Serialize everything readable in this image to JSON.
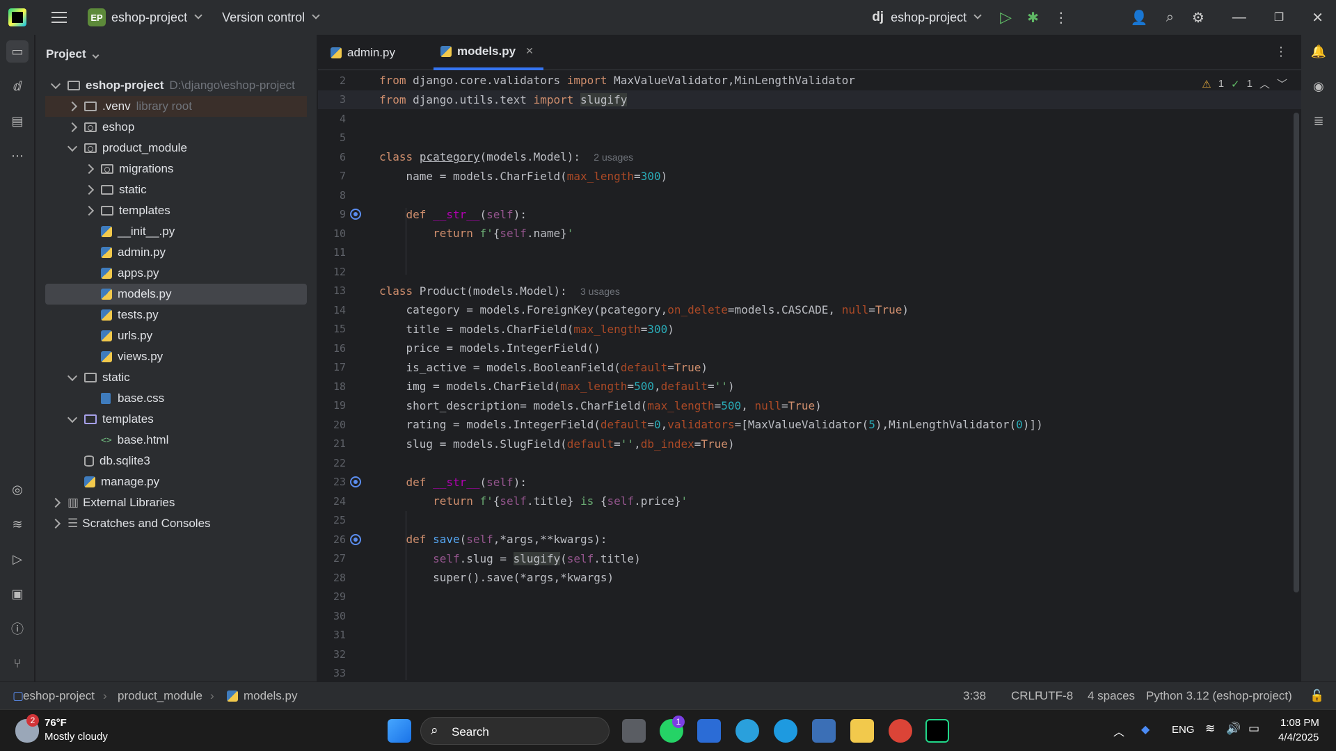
{
  "titlebar": {
    "project_badge": "EP",
    "project_name": "eshop-project",
    "vcs": "Version control",
    "run_config_prefix": "dj",
    "run_config": "eshop-project"
  },
  "panel": {
    "title": "Project"
  },
  "tree": [
    {
      "label": "eshop-project",
      "note": "D:\\django\\eshop-project",
      "bold": true
    },
    {
      "label": ".venv",
      "note": "library root"
    },
    {
      "label": "eshop"
    },
    {
      "label": "product_module"
    },
    {
      "label": "migrations"
    },
    {
      "label": "static"
    },
    {
      "label": "templates"
    },
    {
      "label": "__init__.py"
    },
    {
      "label": "admin.py"
    },
    {
      "label": "apps.py"
    },
    {
      "label": "models.py"
    },
    {
      "label": "tests.py"
    },
    {
      "label": "urls.py"
    },
    {
      "label": "views.py"
    },
    {
      "label": "static"
    },
    {
      "label": "base.css"
    },
    {
      "label": "templates"
    },
    {
      "label": "base.html"
    },
    {
      "label": "db.sqlite3"
    },
    {
      "label": "manage.py"
    },
    {
      "label": "External Libraries"
    },
    {
      "label": "Scratches and Consoles"
    }
  ],
  "tabs": [
    {
      "label": "admin.py"
    },
    {
      "label": "models.py"
    }
  ],
  "editor": {
    "line_numbers": [
      "2",
      "3",
      "4",
      "5",
      "6",
      "7",
      "8",
      "9",
      "10",
      "11",
      "12",
      "13",
      "14",
      "15",
      "16",
      "17",
      "18",
      "19",
      "20",
      "21",
      "22",
      "23",
      "24",
      "25",
      "26",
      "27",
      "28",
      "29",
      "30",
      "31",
      "32",
      "33"
    ],
    "usages_6": "2 usages",
    "usages_13": "3 usages",
    "warn_count": "1",
    "ok_count": "1"
  },
  "statusbar": {
    "crumb1": "eshop-project",
    "crumb2": "product_module",
    "crumb3": "models.py",
    "position": "3:38",
    "line_sep": "CRLF",
    "encoding": "UTF-8",
    "indent": "4 spaces",
    "interpreter": "Python 3.12 (eshop-project)"
  },
  "taskbar": {
    "temp": "76°F",
    "weather": "Mostly cloudy",
    "weather_badge": "2",
    "search": "Search",
    "whatsapp_badge": "1",
    "lang": "ENG",
    "time": "1:08 PM",
    "date": "4/4/2025"
  },
  "colors": {
    "accent": "#3574f0",
    "bg": "#1e1f22",
    "panel": "#2b2d30"
  }
}
